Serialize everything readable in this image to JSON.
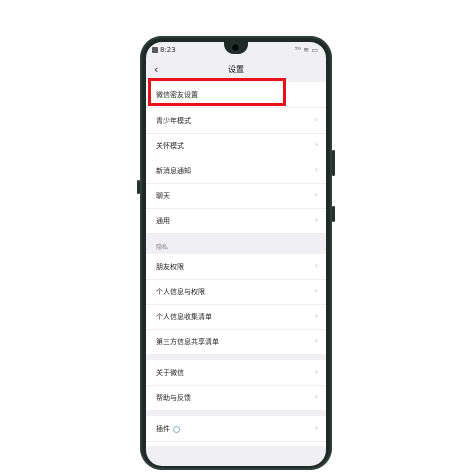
{
  "status_bar": {
    "time": "8:23",
    "right": "⁵ᴳ ≋ ▭"
  },
  "nav": {
    "back_icon": "‹",
    "title": "设置"
  },
  "groups": [
    {
      "items": [
        {
          "label": "微信密友设置"
        }
      ]
    },
    {
      "items": [
        {
          "label": "青少年模式"
        },
        {
          "label": "关怀模式"
        }
      ]
    },
    {
      "items": [
        {
          "label": "新消息通知"
        },
        {
          "label": "聊天"
        },
        {
          "label": "通用"
        }
      ]
    },
    {
      "section": "隐私",
      "items": [
        {
          "label": "朋友权限"
        },
        {
          "label": "个人信息与权限"
        },
        {
          "label": "个人信息收集清单"
        },
        {
          "label": "第三方信息共享清单"
        }
      ]
    },
    {
      "items": [
        {
          "label": "关于微信"
        },
        {
          "label": "帮助与反馈"
        }
      ]
    },
    {
      "items": [
        {
          "label": "插件"
        }
      ]
    }
  ],
  "chevron": "›",
  "colors": {
    "highlight": "#e8121a",
    "phone_frame": "#1f2a26"
  }
}
